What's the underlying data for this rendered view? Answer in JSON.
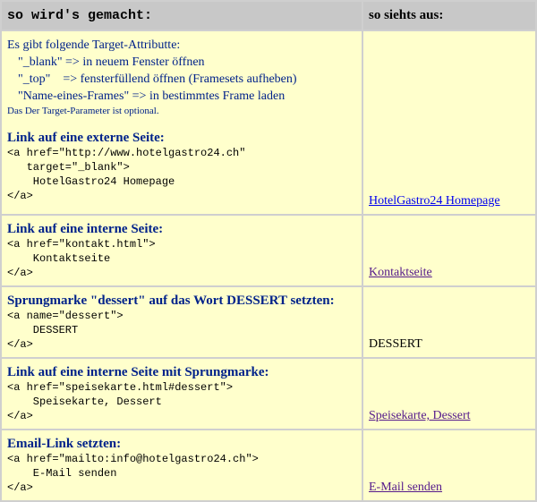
{
  "header": {
    "left": "so wird's gemacht:",
    "right": "so siehts aus:"
  },
  "rows": [
    {
      "intro": {
        "line1": "Es gibt folgende Target-Attributte:",
        "opt1": "\"_blank\" => in neuem Fenster öffnen",
        "opt2": "\"_top\"    => fensterfüllend öffnen (Framesets aufheben)",
        "opt3": "\"Name-eines-Frames\" => in bestimmtes Frame laden",
        "note": "Das Der Target-Parameter ist optional."
      },
      "title": "Link auf eine externe Seite:",
      "code": "<a href=\"http://www.hotelgastro24.ch\"\n   target=\"_blank\">\n    HotelGastro24 Homepage\n</a>",
      "result": "HotelGastro24 Homepage",
      "result_style": "link"
    },
    {
      "title": "Link auf eine interne Seite:",
      "code": "<a href=\"kontakt.html\">\n    Kontaktseite\n</a>",
      "result": "Kontaktseite",
      "result_style": "visited"
    },
    {
      "title": "Sprungmarke \"dessert\" auf das Wort DESSERT setzten:",
      "code": "<a name=\"dessert\">\n    DESSERT\n</a>",
      "result": "DESSERT",
      "result_style": "plain"
    },
    {
      "title": "Link auf eine interne Seite mit Sprungmarke:",
      "code": "<a href=\"speisekarte.html#dessert\">\n    Speisekarte, Dessert\n</a>",
      "result": "Speisekarte, Dessert",
      "result_style": "visited"
    },
    {
      "title": "Email-Link setzten:",
      "code": "<a href=\"mailto:info@hotelgastro24.ch\">\n    E-Mail senden\n</a>",
      "result": "E-Mail senden",
      "result_style": "visited"
    }
  ],
  "colors": {
    "header_bg": "#c8c8c8",
    "cell_bg": "#ffffcc",
    "grid": "#cfcfcf",
    "heading_blue": "#00228a",
    "link_blue": "#0000ee",
    "link_visited": "#551a8b"
  }
}
